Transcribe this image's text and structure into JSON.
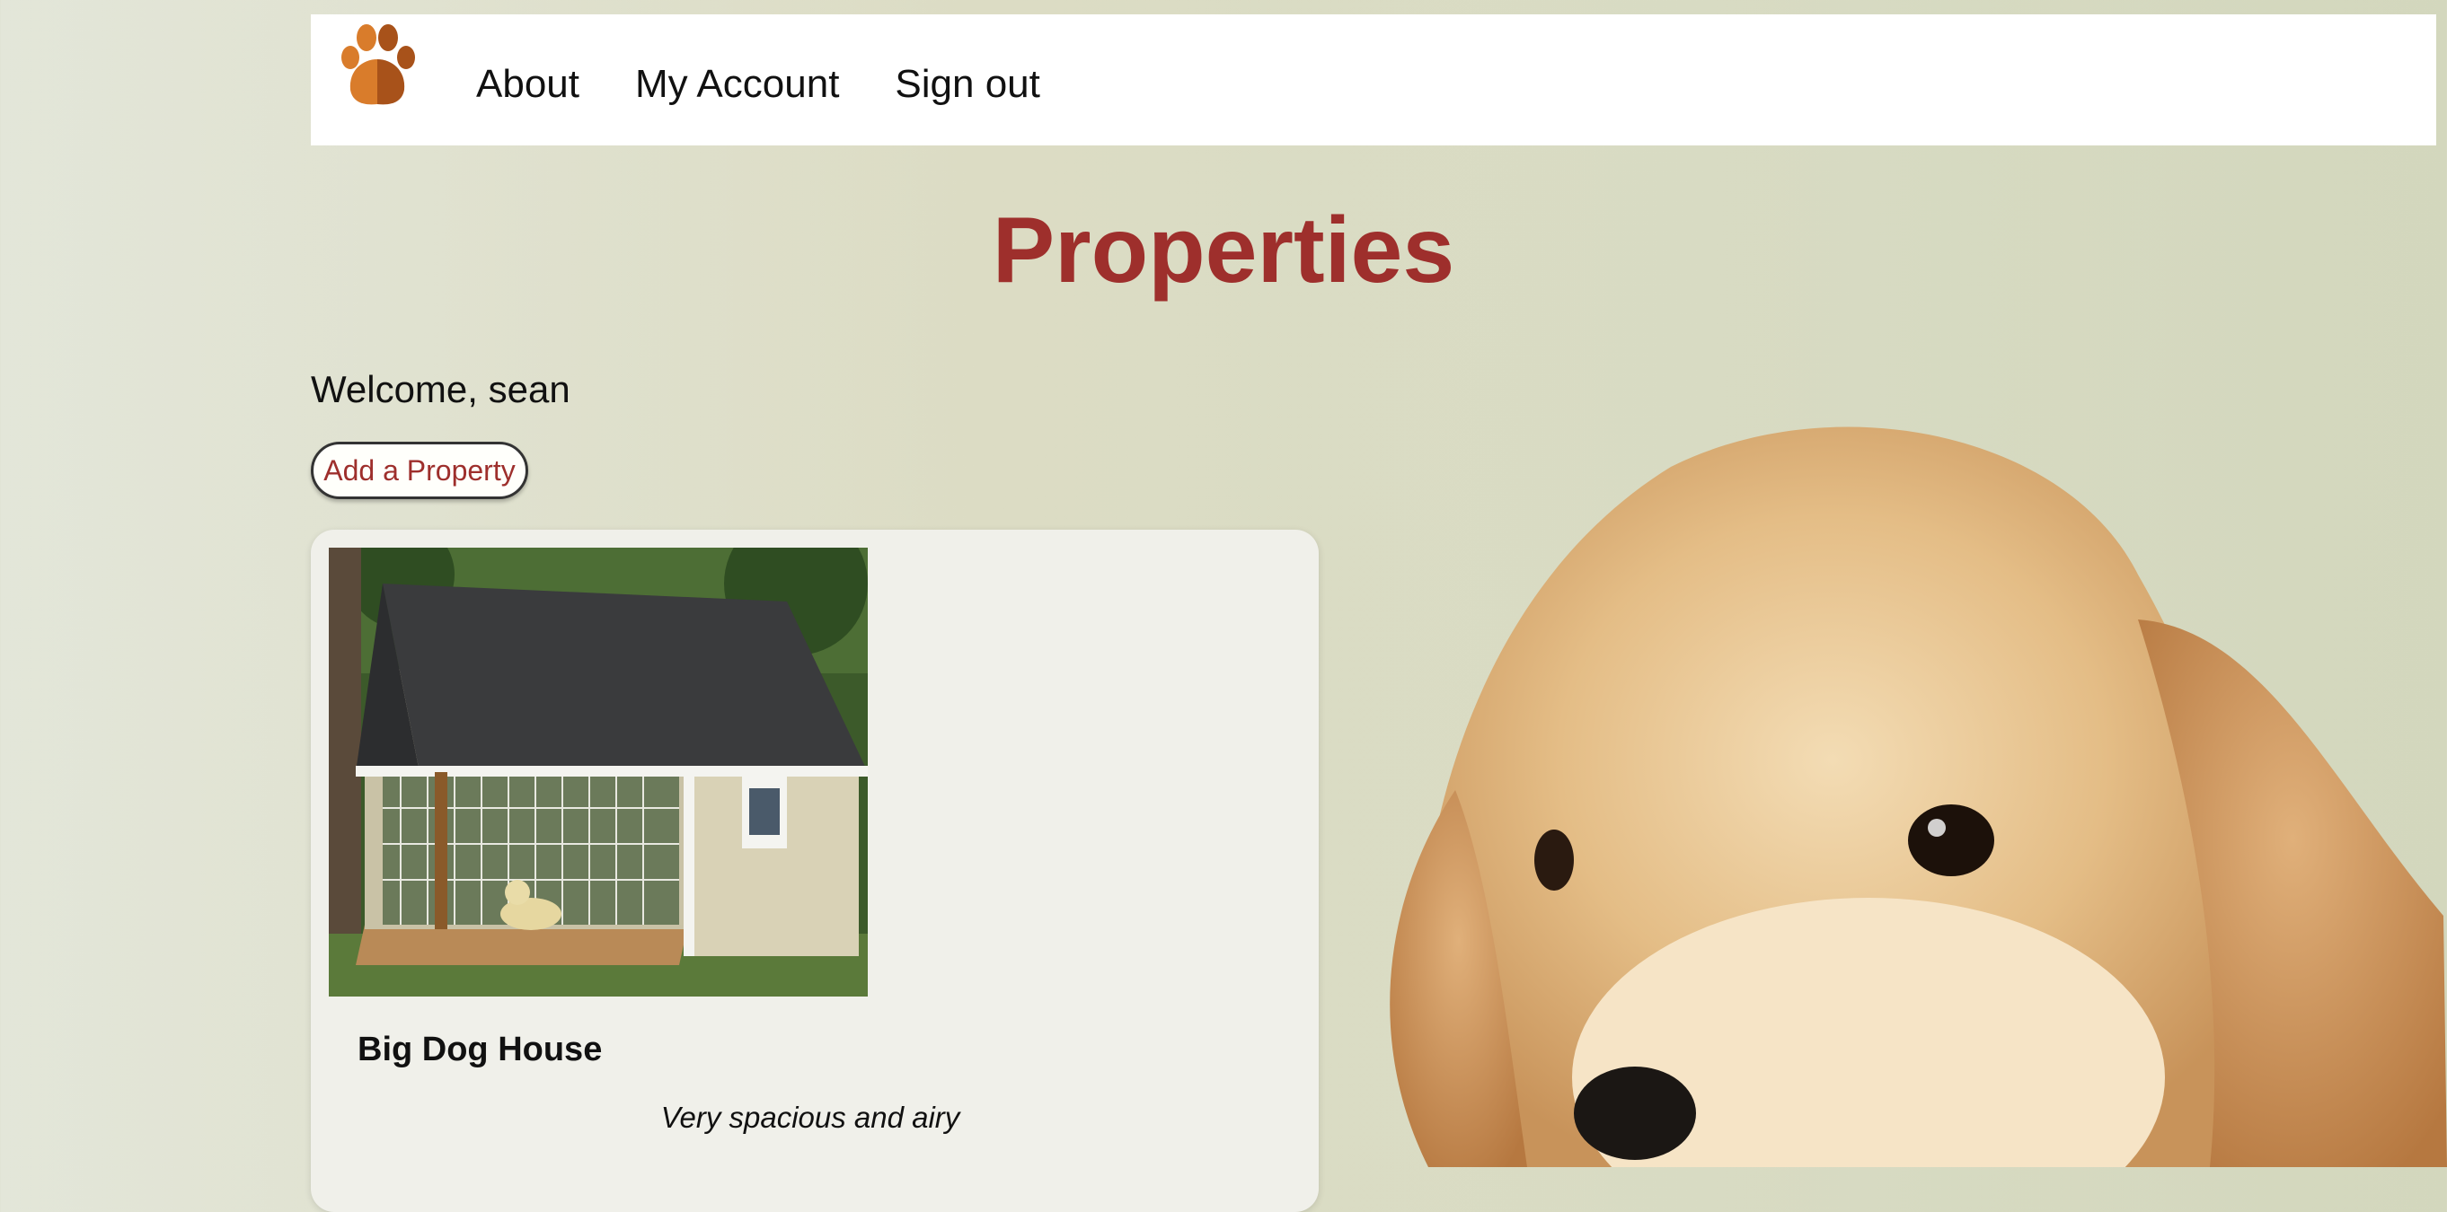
{
  "nav": {
    "logo_icon": "paw-icon",
    "links": [
      "About",
      "My Account",
      "Sign out"
    ]
  },
  "page": {
    "title": "Properties",
    "welcome": "Welcome, sean",
    "add_button": "Add a Property"
  },
  "properties": [
    {
      "name": "Big Dog House",
      "description": "Very spacious and airy",
      "image_icon": "dog-house-photo"
    }
  ],
  "colors": {
    "accent": "#9e2f2c",
    "paw": "#d97c2b"
  }
}
